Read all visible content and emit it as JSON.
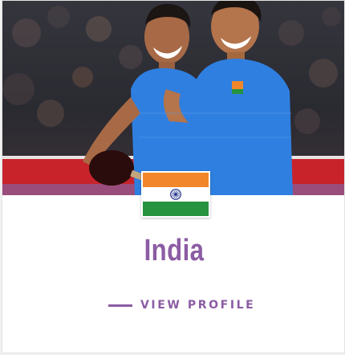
{
  "card": {
    "country_name": "India",
    "link_label": "VIEW PROFILE",
    "photo_alt": "table-tennis-players-photo"
  },
  "colors": {
    "accent": "#8b5ca3",
    "card_bg": "#ffffff",
    "flag_saffron": "#f2862a",
    "flag_green": "#27933f",
    "flag_chakra": "#1f2f8a",
    "jersey_blue": "#2f7fe0"
  }
}
